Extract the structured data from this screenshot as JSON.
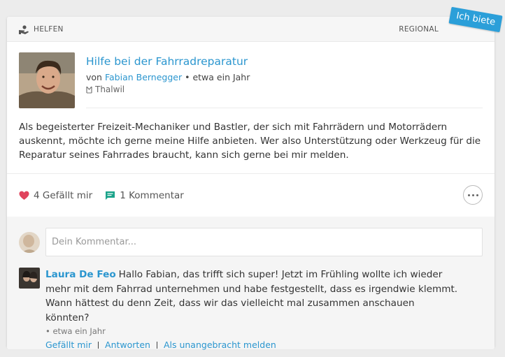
{
  "header": {
    "category_icon": "helping-hand-icon",
    "category": "HELFEN",
    "region": "REGIONAL",
    "ribbon": "Ich biete"
  },
  "post": {
    "title": "Hilfe bei der Fahrradreparatur",
    "by_prefix": "von",
    "author": "Fabian Bernegger",
    "time": "• etwa ein Jahr",
    "location": "Thalwil",
    "location_icon": "map-pin-icon",
    "body": "Als begeisterter Freizeit-Mechaniker und Bastler, der sich mit Fahrrädern und Motorrädern auskennt, möchte ich gerne meine Hilfe anbieten. Wer also Unterstützung oder Werkzeug für die Reparatur seines Fahrrades braucht, kann sich gerne bei mir melden."
  },
  "actions": {
    "likes": "4 Gefällt mir",
    "comments": "1 Kommentar",
    "like_icon": "heart-icon",
    "comment_icon": "comment-icon",
    "more_icon": "more-icon"
  },
  "compose": {
    "placeholder": "Dein Kommentar..."
  },
  "comment": {
    "author": "Laura De Feo",
    "text": "Hallo Fabian, das trifft sich super! Jetzt im Frühling wollte ich wieder mehr mit dem Fahrrad unternehmen und habe festgestellt, dass es irgendwie klemmt. Wann hättest du denn Zeit, dass wir das vielleicht mal zusammen anschauen könnten?",
    "time": "• etwa ein Jahr",
    "like_link": "Gefällt mir",
    "reply_link": "Antworten",
    "report_link": "Als unangebracht melden"
  },
  "colors": {
    "accent": "#2b96cf",
    "ribbon": "#2b9fd9",
    "heart": "#e0445d",
    "comment_icon": "#1aa38a"
  }
}
